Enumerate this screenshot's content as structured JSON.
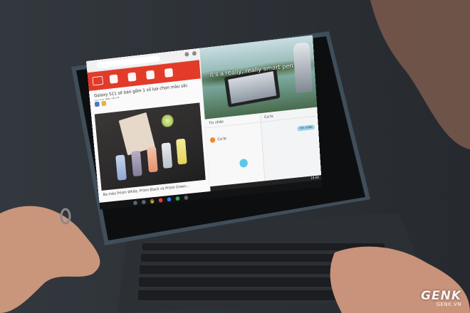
{
  "left_app": {
    "article_title": "Galaxy S11 sẽ bán gồm 1 số lựa chọn màu sắc quen thuộc?",
    "caption": "Ba màu Prism White, Prism Black và Prism Green…"
  },
  "right_video": {
    "subtitle": "it's a really, really smart pen"
  },
  "messages": {
    "left_title": "Tin nhắn",
    "contact_name": "Cư lo",
    "right_title": "Cư lo",
    "bubble_text": "Xin chào"
  },
  "status": {
    "time": "14:56"
  },
  "watermark": {
    "logo": "GENK",
    "sub": "GENK.VN"
  },
  "colors": {
    "accent_red": "#e23b2a",
    "fab_blue": "#5ac8e8"
  },
  "icons": [
    "home-icon",
    "back-icon",
    "recents-icon",
    "chrome-icon",
    "youtube-icon",
    "messages-icon",
    "phone-icon"
  ]
}
